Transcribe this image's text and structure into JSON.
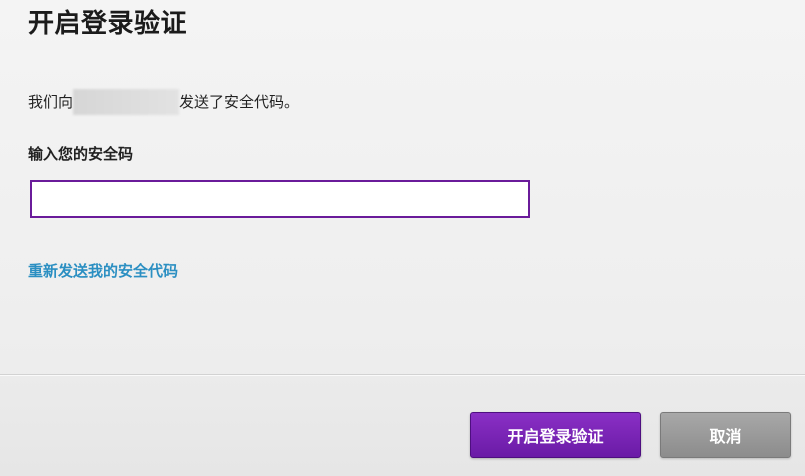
{
  "dialog": {
    "title": "开启登录验证",
    "sent_prefix": "我们向",
    "sent_suffix": "发送了安全代码。",
    "field_label": "输入您的安全码",
    "code_value": "",
    "resend_link": "重新发送我的安全代码"
  },
  "footer": {
    "confirm_label": "开启登录验证",
    "cancel_label": "取消"
  },
  "colors": {
    "accent_purple": "#6a1b9a",
    "link_blue": "#2b8fc2",
    "cancel_gray": "#999999"
  }
}
